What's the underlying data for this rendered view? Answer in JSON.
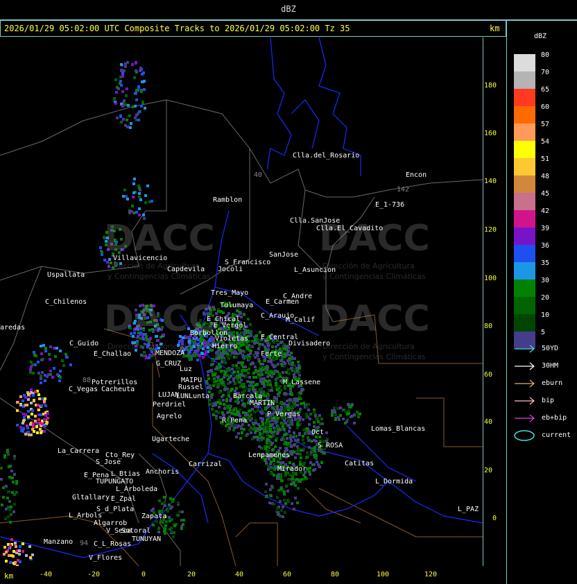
{
  "window": {
    "title": "dBZ"
  },
  "header": {
    "text": "2026/01/29 05:02:00 UTC Composite Tracks to 2026/01/29 05:02:00 Tz 35",
    "km_label": "km"
  },
  "axes": {
    "y_ticks": [
      "180",
      "160",
      "140",
      "120",
      "100",
      "80",
      "60",
      "40",
      "20",
      "0"
    ],
    "x_ticks": [
      "-40",
      "-20",
      "0",
      "20",
      "40",
      "60",
      "80",
      "100",
      "120"
    ],
    "x_unit": "km"
  },
  "legend": {
    "title": "dBZ",
    "bins": [
      {
        "label": "80",
        "color": "#dcdcdc"
      },
      {
        "label": "70",
        "color": "#b4b4b4"
      },
      {
        "label": "65",
        "color": "#ff3a20"
      },
      {
        "label": "60",
        "color": "#ff6a00"
      },
      {
        "label": "57",
        "color": "#ff9a5a"
      },
      {
        "label": "54",
        "color": "#ffff00"
      },
      {
        "label": "51",
        "color": "#ffc832"
      },
      {
        "label": "48",
        "color": "#d2873c"
      },
      {
        "label": "45",
        "color": "#c8708c"
      },
      {
        "label": "42",
        "color": "#d2148c"
      },
      {
        "label": "39",
        "color": "#7814c8"
      },
      {
        "label": "36",
        "color": "#1e50f0"
      },
      {
        "label": "35",
        "color": "#1e96e6"
      },
      {
        "label": "30",
        "color": "#008200"
      },
      {
        "label": "20",
        "color": "#006400"
      },
      {
        "label": "10",
        "color": "#004600"
      },
      {
        "label": "5",
        "color": "#463c8c"
      }
    ],
    "tracks": [
      {
        "label": "50YD",
        "color": "#40e0e0",
        "icon": "arrow-right-icon"
      },
      {
        "label": "30HM",
        "color": "#ffffff",
        "icon": "arrow-right-icon"
      },
      {
        "label": "eburn",
        "color": "#e0b070",
        "icon": "arrow-right-icon"
      },
      {
        "label": "bip",
        "color": "#ffc0d0",
        "icon": "arrow-right-icon"
      },
      {
        "label": "eb+bip",
        "color": "#e040e0",
        "icon": "arrow-right-icon"
      },
      {
        "label": "current",
        "color": "#40e0e0",
        "icon": "ellipse-icon"
      }
    ]
  },
  "watermark": {
    "brand": "DACC",
    "line1": "Dirección de Agricultura",
    "line2": "y Contingencias Climáticas"
  },
  "places": [
    "Clla.del_Rosario",
    "Encon",
    "142",
    "E_1-736",
    "Ramblon",
    "Clla.SanJose",
    "Clla.El_Cavadito",
    "40",
    "Villavicencio",
    "S_Francisco",
    "SanJose",
    "Capdevila",
    "Jocoli",
    "L_Asuncion",
    "Uspallata",
    "Tres_Mayo",
    "C_Andre",
    "C_Chilenos",
    "Tulumaya",
    "E_Carmen",
    "C_Araujo",
    "M_Calif",
    "aredas",
    "E_Chical",
    "E_Vergel",
    "Violetas",
    "E_Central",
    "Divisadero",
    "C_Guido",
    "Borbollon",
    "Hierro",
    "Ferte",
    "E_Challao",
    "MENDOZA",
    "G_CRUZ",
    "Luz",
    "M_Lassene",
    "88",
    "Potrerillos",
    "MAIPU",
    "Russel",
    "C_Vegas",
    "Cacheuta",
    "LUJAN",
    "LUNLunta",
    "Barcala",
    "MARTIN",
    "Perdriel",
    "Agrelo",
    "P_Vergas",
    "R_Pena",
    "Lomas_Blancas",
    "Ugarteche",
    "Oct",
    "La_Carrera",
    "Cto_Rey",
    "S_Jose",
    "S_ROSA",
    "Carrizal",
    "Lenpamenes",
    "Catitas",
    "E_Pena",
    "Anchoris",
    "L_Btias",
    "Mirador",
    "TUPUNGATO",
    "L_Dormida",
    "L_Arboleda",
    "Gltallary",
    "E_Zpal",
    "S_d_Plata",
    "L_Arbols",
    "Zapata",
    "L_PAZ",
    "Algarrob",
    "V_Seca",
    "Sotoral",
    "Manzano",
    "94",
    "TUNUYAN",
    "C_L_Rosas",
    "V_Flores"
  ]
}
